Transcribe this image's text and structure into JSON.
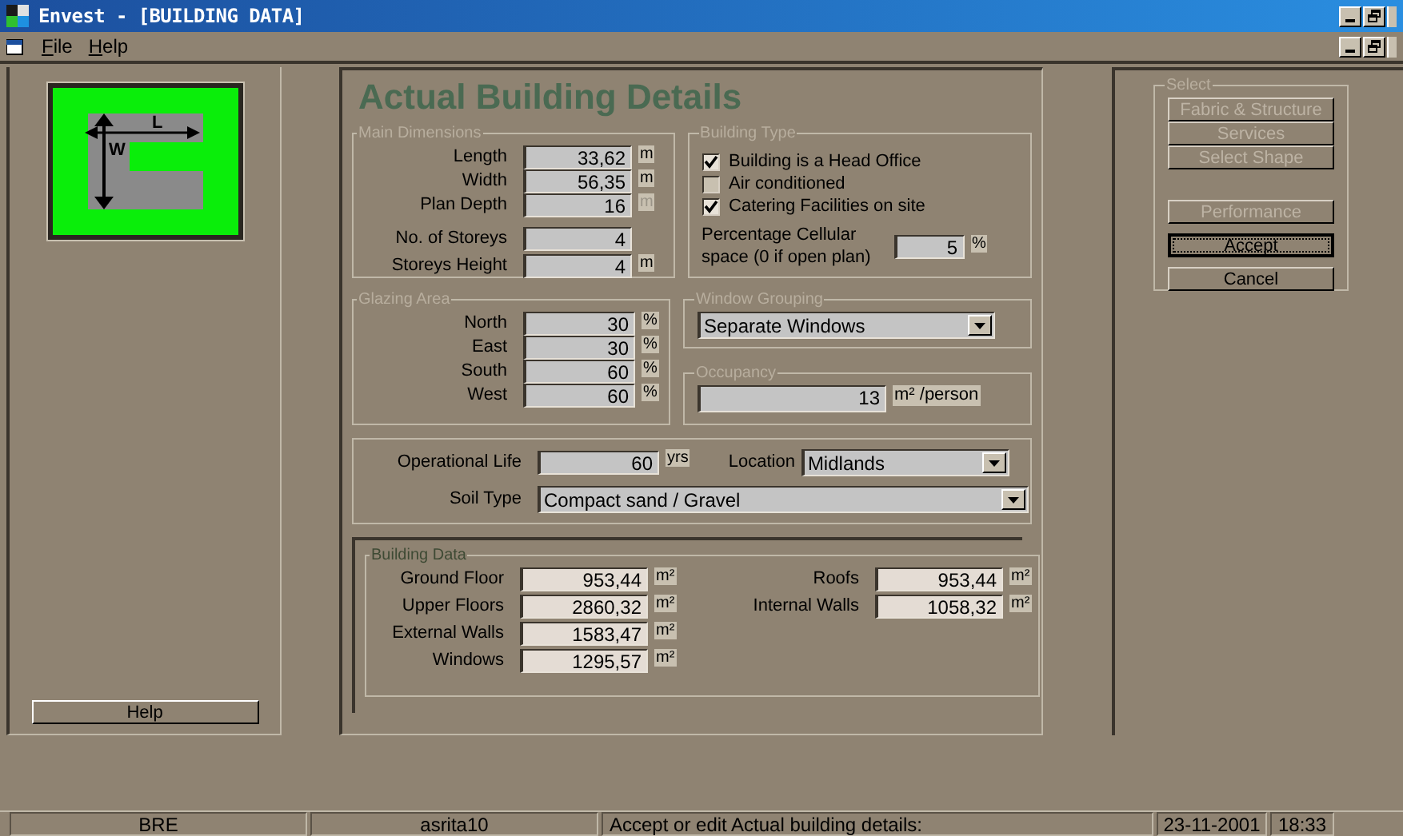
{
  "window": {
    "title": "Envest - [BUILDING DATA]"
  },
  "menu": [
    {
      "label": "File"
    },
    {
      "label": "Help"
    }
  ],
  "logo": {
    "length_label": "L",
    "width_label": "W"
  },
  "help_button": {
    "label": "Help"
  },
  "heading": "Actual Building Details",
  "main_dimensions": {
    "title": "Main Dimensions",
    "fields": [
      {
        "label": "Length",
        "value": "33,62",
        "unit": "m",
        "unit_disabled": false
      },
      {
        "label": "Width",
        "value": "56,35",
        "unit": "m",
        "unit_disabled": false
      },
      {
        "label": "Plan Depth",
        "value": "16",
        "unit": "m",
        "unit_disabled": true
      }
    ],
    "storey_fields": [
      {
        "label": "No. of Storeys",
        "value": "4"
      },
      {
        "label": "Storeys Height",
        "value": "4",
        "unit": "m",
        "unit_disabled": false
      }
    ]
  },
  "building_type": {
    "title": "Building Type",
    "options": [
      {
        "label": "Building is a Head Office",
        "checked": true
      },
      {
        "label": "Air conditioned",
        "checked": false
      },
      {
        "label": "Catering Facilities on site",
        "checked": true
      }
    ],
    "cellular": {
      "label": "Percentage Cellular space (0 if open plan)",
      "value": "5",
      "unit": "%"
    }
  },
  "glazing_area": {
    "title": "Glazing Area",
    "fields": [
      {
        "label": "North",
        "value": "30",
        "unit": "%"
      },
      {
        "label": "East",
        "value": "30",
        "unit": "%"
      },
      {
        "label": "South",
        "value": "60",
        "unit": "%"
      },
      {
        "label": "West",
        "value": "60",
        "unit": "%"
      }
    ]
  },
  "window_grouping": {
    "title": "Window Grouping",
    "value": "Separate Windows"
  },
  "occupancy": {
    "title": "Occupancy",
    "value": "13",
    "unit": "m² /person"
  },
  "site": {
    "life_label": "Operational Life",
    "life_value": "60",
    "life_unit": "yrs",
    "location_label": "Location",
    "location_value": "Midlands",
    "soil_label": "Soil Type",
    "soil_value": "Compact sand / Gravel"
  },
  "building_data": {
    "title": "Building Data",
    "left": [
      {
        "label": "Ground Floor",
        "value": "953,44",
        "unit": "m²"
      },
      {
        "label": "Upper Floors",
        "value": "2860,32",
        "unit": "m²"
      },
      {
        "label": "External Walls",
        "value": "1583,47",
        "unit": "m²"
      },
      {
        "label": "Windows",
        "value": "1295,57",
        "unit": "m²"
      }
    ],
    "right": [
      {
        "label": "Roofs",
        "value": "953,44",
        "unit": "m²"
      },
      {
        "label": "Internal Walls",
        "value": "1058,32",
        "unit": "m²"
      }
    ]
  },
  "select": {
    "title": "Select",
    "buttons": [
      {
        "label": "Fabric & Structure",
        "disabled": true
      },
      {
        "label": "Services",
        "disabled": true
      },
      {
        "label": "Select Shape",
        "disabled": true
      }
    ]
  },
  "actions": [
    {
      "label": "Performance",
      "disabled": true,
      "focused": false
    },
    {
      "label": "Accept",
      "disabled": false,
      "focused": true
    },
    {
      "label": "Cancel",
      "disabled": false,
      "focused": false
    }
  ],
  "status_bar": [
    "BRE",
    "asrita10",
    "Accept or edit Actual building details:",
    "23-11-2001",
    "18:33"
  ]
}
